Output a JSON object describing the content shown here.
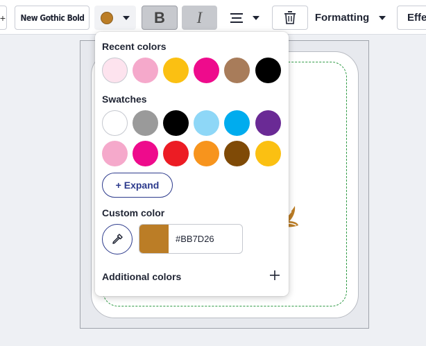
{
  "toolbar": {
    "partial_left_glyph": "+",
    "font_name": "New Gothic Bold",
    "text_color": "#BB7D26",
    "bold_label": "B",
    "italic_label": "I",
    "formatting_label": "Formatting",
    "effects_label": "Effe",
    "icons": [
      "text-color-swatch-icon",
      "bold-icon",
      "italic-icon",
      "align-icon",
      "trash-icon",
      "chevron-down-icon"
    ]
  },
  "color_picker": {
    "recent_title": "Recent colors",
    "recent_colors": [
      "#FDE3EE",
      "#F5A9CB",
      "#FBC012",
      "#EE0B8C",
      "#A87C5A",
      "#000000"
    ],
    "swatches_title": "Swatches",
    "swatches": [
      "#FFFFFF",
      "#9A9A9A",
      "#000000",
      "#8ED7F7",
      "#00ACEE",
      "#6A2A95",
      "#F5A9CB",
      "#EE0B8C",
      "#EC1C24",
      "#F7941D",
      "#7F4A06",
      "#FBC012"
    ],
    "expand_label": "+ Expand",
    "custom_title": "Custom color",
    "custom_hex": "#BB7D26",
    "additional_label": "Additional colors"
  },
  "canvas": {
    "safe_line_color": "#2E9A44",
    "illustration": "bird-icon"
  }
}
